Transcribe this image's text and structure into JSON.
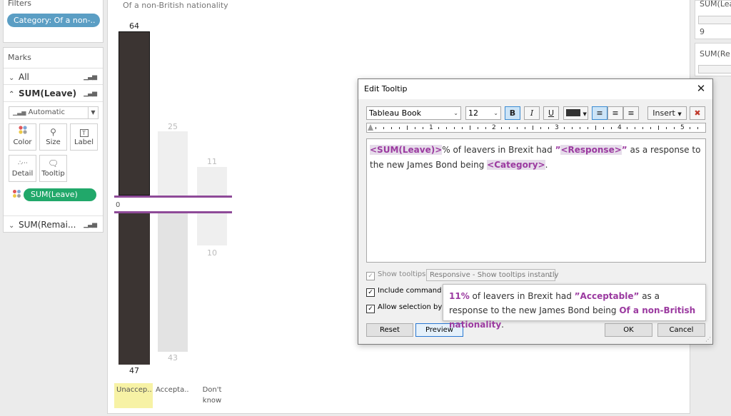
{
  "filters": {
    "title": "Filters",
    "pill": "Category: Of a non-.."
  },
  "marks": {
    "title": "Marks",
    "rows": [
      {
        "label": "All"
      },
      {
        "label": "SUM(Leave)"
      },
      {
        "label": "SUM(Remai..."
      }
    ],
    "mark_type": "Automatic",
    "buttons": [
      "Color",
      "Size",
      "Label",
      "Detail",
      "Tooltip"
    ],
    "color_pill": "SUM(Leave)"
  },
  "view": {
    "header": "Of a non-British nationality",
    "zero_label": "0",
    "colors": {
      "dark_bar": "#3b3432",
      "light_bar": "#e3e3e3",
      "lighter_bar": "#efefef",
      "purple_line": "#8e4a98",
      "highlight": "#f7f2a5"
    }
  },
  "chart_data": {
    "type": "bar",
    "categories": [
      "Unaccep..",
      "Accepta..",
      "Don't know"
    ],
    "series": [
      {
        "values": [
          64,
          25,
          11
        ]
      },
      {
        "values": [
          47,
          43,
          10
        ]
      }
    ],
    "value_labels_top": [
      "64",
      "25",
      "11"
    ],
    "value_labels_bottom": [
      "47",
      "43",
      "10"
    ]
  },
  "right_panel": {
    "card1_title": "SUM(Lea",
    "card1_value": "9",
    "card2_title": "SUM(Re"
  },
  "dialog": {
    "title": "Edit Tooltip",
    "font": "Tableau Book",
    "size": "12",
    "bold": "B",
    "italic": "I",
    "underline": "U",
    "insert": "Insert",
    "ruler_numbers": [
      "1",
      "2",
      "3",
      "4",
      "5"
    ],
    "editor": {
      "f1": "<SUM(Leave)>",
      "t1": "% of leavers in Brexit had ",
      "q1": "”",
      "f2": "<Response>",
      "q2": "”",
      "t2": " as a response to the new James Bond being ",
      "f3": "<Category>",
      "t3": "."
    },
    "show_tooltips": "Show tooltips",
    "responsive": "Responsive - Show tooltips instantly",
    "include_buttons": "Include command buttons",
    "allow_selection": "Allow selection by category",
    "reset": "Reset",
    "preview": "Preview",
    "ok": "OK",
    "cancel": "Cancel"
  },
  "preview_tip": {
    "value": "11%",
    "t1": " of leavers in Brexit had ",
    "response": "”Acceptable”",
    "t2": " as a response to the new James Bond being ",
    "category": "Of a non-British nationality",
    "t3": "."
  }
}
